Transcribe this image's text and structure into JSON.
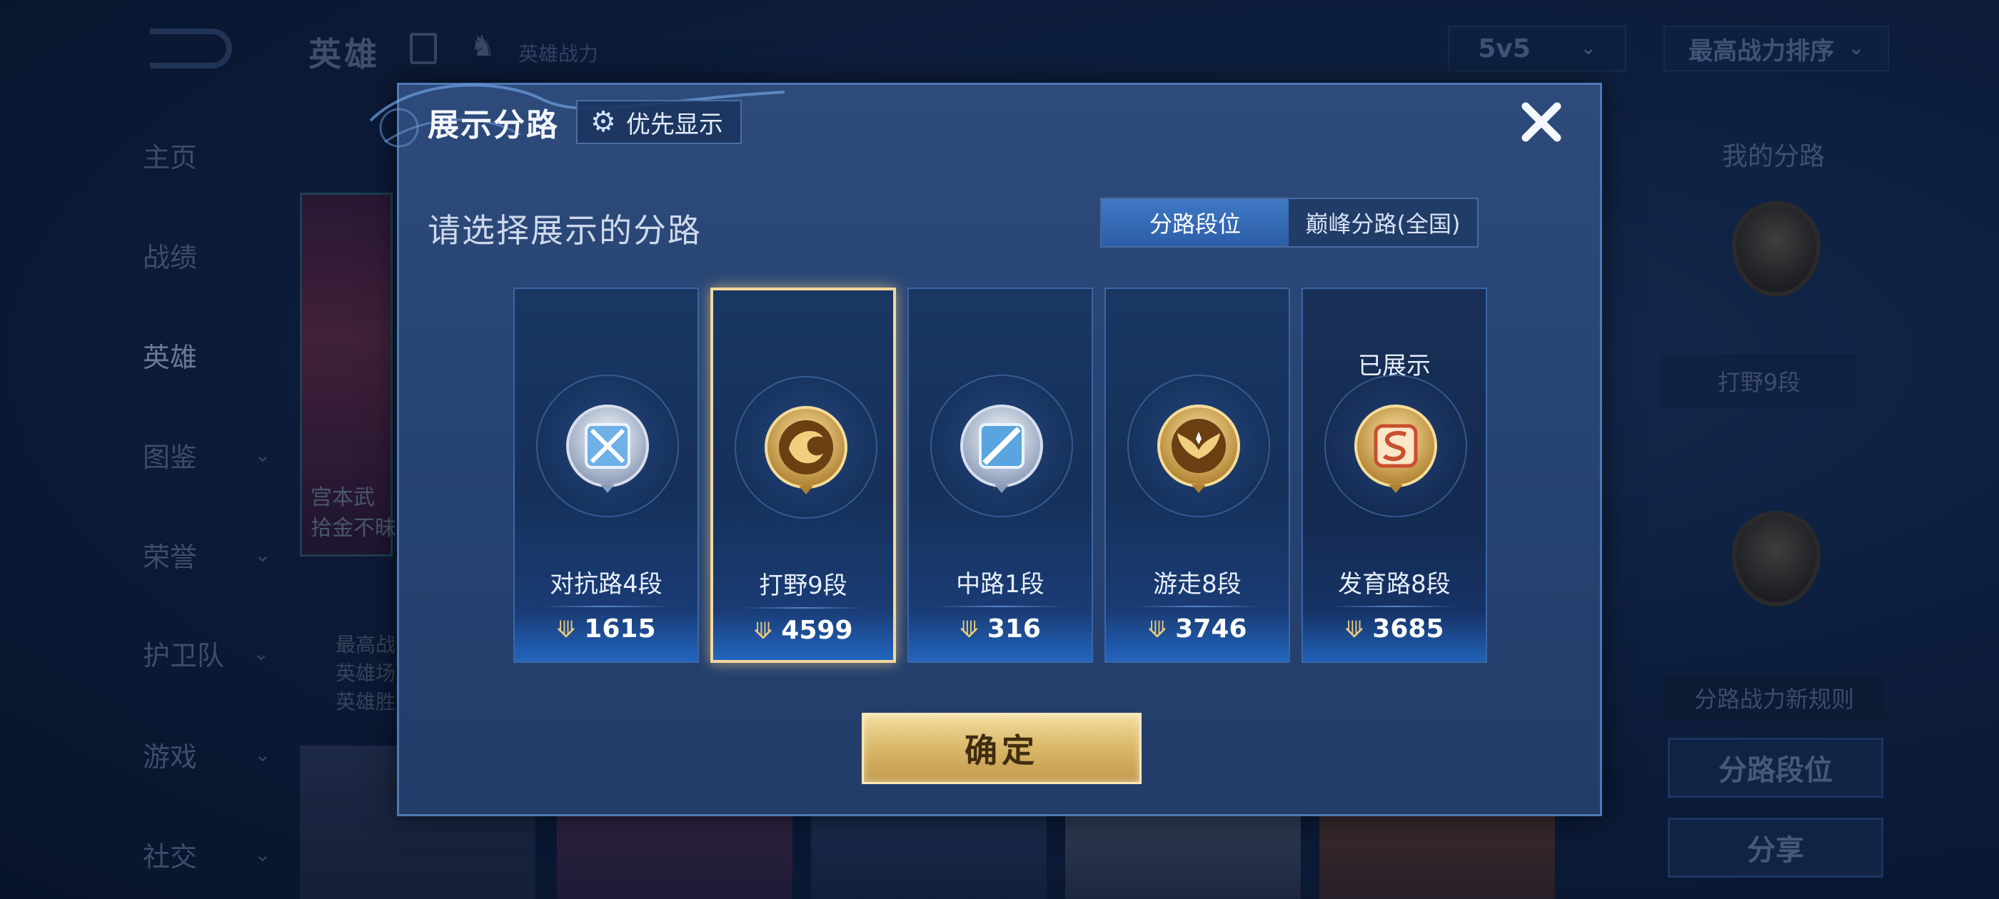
{
  "background": {
    "top_title": "英雄",
    "power_label": "英雄战力",
    "mode_select": "5v5",
    "sort_select": "最高战力排序",
    "nav": [
      {
        "label": "主页"
      },
      {
        "label": "战绩"
      },
      {
        "label": "英雄"
      },
      {
        "label": "图鉴"
      },
      {
        "label": "荣誉"
      },
      {
        "label": "护卫队"
      },
      {
        "label": "游戏"
      },
      {
        "label": "社交"
      }
    ],
    "hero_card_line1": "宫本武",
    "hero_card_line2": "拾金不昧",
    "hero_stats": [
      "最高战",
      "英雄场",
      "英雄胜"
    ],
    "right_panel": {
      "title": "我的分路",
      "lane_label": "打野9段",
      "rule": "分路战力新规则",
      "lane_rank_button": "分路段位",
      "share_button": "分享"
    }
  },
  "modal": {
    "title": "展示分路",
    "priority_button": "优先显示",
    "subtitle": "请选择展示的分路",
    "tabs": [
      {
        "label": "分路段位",
        "active": true
      },
      {
        "label": "巅峰分路(全国)",
        "active": false
      }
    ],
    "lanes": [
      {
        "name": "对抗路4段",
        "score": "1615",
        "icon": "sword-shield-icon",
        "tier": "silver"
      },
      {
        "name": "打野9段",
        "score": "4599",
        "icon": "dragon-icon",
        "tier": "gold",
        "selected": true
      },
      {
        "name": "中路1段",
        "score": "316",
        "icon": "wand-icon",
        "tier": "silver"
      },
      {
        "name": "游走8段",
        "score": "3746",
        "icon": "wings-icon",
        "tier": "gold"
      },
      {
        "name": "发育路8段",
        "score": "3685",
        "icon": "marksman-icon",
        "tier": "gold",
        "status": "已展示"
      }
    ],
    "confirm_button": "确定"
  },
  "colors": {
    "gold": "#e9c97a",
    "accent_blue": "#3f78c4",
    "selected_border": "#f3d79a"
  }
}
